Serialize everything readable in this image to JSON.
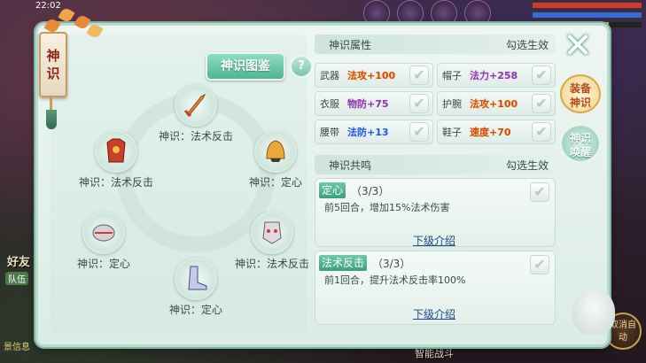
{
  "status": {
    "time": "22:02"
  },
  "hud": {
    "friends_label": "好友",
    "team_tag": "队伍",
    "bottom_text": "景信息"
  },
  "bottom": {
    "smart_battle": "智能战斗",
    "auto_button": "取消自动"
  },
  "ribbon": {
    "title_chars": [
      "神",
      "识"
    ]
  },
  "left_panel": {
    "atlas_button": "神识图鉴",
    "help_button": "?",
    "slots": [
      {
        "label": "神识：法术反击",
        "gear": "sword",
        "color": "#e0902a"
      },
      {
        "label": "神识：法术反击",
        "gear": "armor",
        "color": "#c8402a"
      },
      {
        "label": "神识：定心",
        "gear": "hat",
        "color": "#e8a83a"
      },
      {
        "label": "神识：定心",
        "gear": "bracer",
        "color": "#c8c0c8"
      },
      {
        "label": "神识：法术反击",
        "gear": "mask",
        "color": "#c8c0c8"
      },
      {
        "label": "神识：定心",
        "gear": "boots",
        "color": "#b8b8d8"
      }
    ]
  },
  "attributes": {
    "title": "神识属性",
    "hint": "勾选生效",
    "items": [
      {
        "slot": "武器",
        "value": "法攻+100",
        "color": "red"
      },
      {
        "slot": "帽子",
        "value": "法力+258",
        "color": "purple"
      },
      {
        "slot": "衣服",
        "value": "物防+75",
        "color": "purple"
      },
      {
        "slot": "护腕",
        "value": "法攻+100",
        "color": "red"
      },
      {
        "slot": "腰带",
        "value": "法防+13",
        "color": "blue"
      },
      {
        "slot": "鞋子",
        "value": "速度+70",
        "color": "red"
      }
    ]
  },
  "resonance": {
    "title": "神识共鸣",
    "hint": "勾选生效",
    "items": [
      {
        "name": "定心",
        "count": "（3/3）",
        "desc": "前5回合，增加15%法术伤害",
        "link": "下级介绍"
      },
      {
        "name": "法术反击",
        "count": "（3/3）",
        "desc": "前1回合，提升法术反击率100%",
        "link": "下级介绍"
      }
    ]
  },
  "side_tabs": {
    "close": "✕",
    "equip_tab": [
      "装备",
      "神识"
    ],
    "awaken_tab": [
      "神识",
      "唤醒"
    ]
  },
  "colors": {
    "accent": "#4fb596",
    "value_red": "#d14a1a",
    "value_purple": "#8a3aa8",
    "value_blue": "#2a5ad8"
  }
}
